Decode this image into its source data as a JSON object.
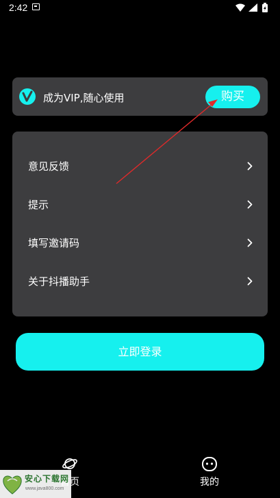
{
  "status_bar": {
    "time": "2:42",
    "icons": [
      "notification-icon",
      "wifi-icon",
      "signal-icon",
      "battery-icon"
    ]
  },
  "vip_banner": {
    "logo_icon": "vip-v-logo",
    "text": "成为VIP,随心使用",
    "buy_label": "购买"
  },
  "menu": {
    "items": [
      {
        "label": "意见反馈",
        "icon": "chevron-right"
      },
      {
        "label": "提示",
        "icon": "chevron-right"
      },
      {
        "label": "填写邀请码",
        "icon": "chevron-right"
      },
      {
        "label": "关于抖播助手",
        "icon": "chevron-right"
      }
    ]
  },
  "login_label": "立即登录",
  "bottom_nav": {
    "tabs": [
      {
        "label": "首页",
        "icon": "planet-icon"
      },
      {
        "label": "我的",
        "icon": "face-icon"
      }
    ]
  },
  "watermark": {
    "name": "安心下载网",
    "url": "www.java800.com",
    "badge": "安心"
  },
  "colors": {
    "background": "#000000",
    "card": "#3d3d3f",
    "accent": "#16f0ee",
    "arrow": "#e02a2a"
  }
}
